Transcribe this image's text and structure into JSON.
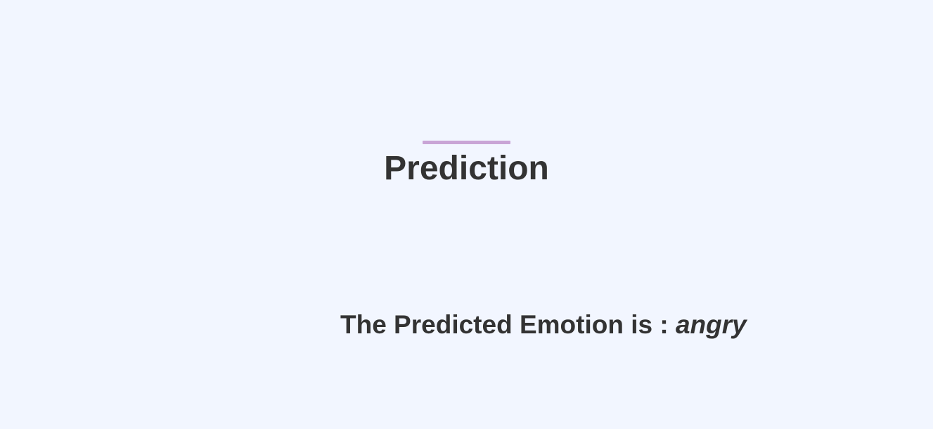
{
  "header": {
    "title": "Prediction",
    "accent_color": "#c9a5d6"
  },
  "result": {
    "label": "The Predicted Emotion is : ",
    "value": "angry"
  },
  "theme": {
    "background": "#f2f6ff",
    "text": "#333333"
  }
}
